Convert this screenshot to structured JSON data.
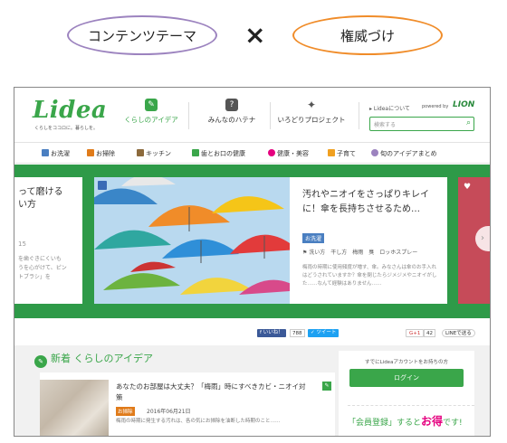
{
  "caption": {
    "left_label": "コンテンツテーマ",
    "times": "×",
    "right_label": "権威づけ"
  },
  "header": {
    "logo": "Lidea",
    "logo_sub": "くらしをココロに。暮らしを。",
    "nav": [
      {
        "label": "くらしのアイデア",
        "icon": "idea-icon"
      },
      {
        "label": "みんなのハテナ",
        "icon": "question-icon"
      },
      {
        "label": "いろどりプロジェクト",
        "icon": "sparkle-icon"
      }
    ],
    "about": "Lideaについて",
    "powered": "powered by",
    "brand": "LION",
    "search_placeholder": "検索する"
  },
  "categories": [
    {
      "label": "お洗濯",
      "color": "#4a7fc1"
    },
    {
      "label": "お掃除",
      "color": "#e07b1a"
    },
    {
      "label": "キッチン",
      "color": "#8c6a3c"
    },
    {
      "label": "歯とお口の健康",
      "color": "#3aa64a"
    },
    {
      "label": "健康・美容",
      "color": "#e5007f"
    },
    {
      "label": "子育て",
      "color": "#f0a020"
    },
    {
      "label": "旬のアイデアまとめ",
      "color": "#9c83bf"
    }
  ],
  "hero": {
    "left_card": {
      "title": "って磨ける\nい方",
      "count": "15",
      "desc": "を歯ぐきにくいも\nうを心がけて、ピン\nトブラシ」を"
    },
    "main_card": {
      "title": "汚れやニオイをさっぱりキレイに！傘を長持ちさせるため…",
      "tag": "お洗濯",
      "keywords": "洗い方　干し方　梅雨　臭　ロッホスプレー",
      "desc": "梅雨の時期に使用頻度が増す、傘。みなさんは傘のお手入れはどうされていますか？傘を閉じたらジメジメやニオイがした……なんて経験はありません……"
    },
    "slides_total": 5,
    "slide_active": 1
  },
  "social": {
    "like": "いいね！",
    "like_count": "788",
    "tweet": "ツイート",
    "gplus": "G+1",
    "gplus_count": "42",
    "line": "LINEで送る"
  },
  "new_section": {
    "heading": "新着 くらしのアイデア",
    "article": {
      "title": "あなたのお部屋は大丈夫？「梅雨」時にすべきカビ・ニオイ対策",
      "badge": "お掃除",
      "date": "2016年06月21日",
      "desc": "梅雨の時期に発生する汚れは、各の気にお掃除を油断した時期のこと……"
    }
  },
  "login": {
    "note": "すでにLideaアカウントをお持ちの方",
    "button": "ログイン",
    "register_pre": "「会員登録」すると",
    "register_em": "お得",
    "register_post": "です!"
  }
}
